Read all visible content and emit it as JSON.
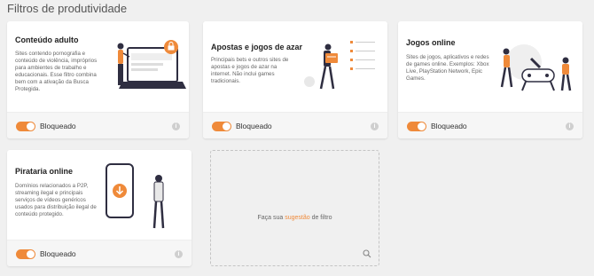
{
  "page": {
    "title": "Filtros de produtividade"
  },
  "cards": [
    {
      "title": "Conteúdo adulto",
      "description": "Sites contendo pornografia e conteúdo de violência, impróprios para ambientes de trabalho e educacionais. Esse filtro combina bem com a ativação da Busca Protegida.",
      "status": "Bloqueado",
      "enabled": true
    },
    {
      "title": "Apostas e jogos de azar",
      "description": "Principais bets e outros sites de apostas e jogos de azar na internet. Não inclui games tradicionais.",
      "status": "Bloqueado",
      "enabled": true
    },
    {
      "title": "Jogos online",
      "description": "Sites de jogos, aplicativos e redes de games online. Exemplos: Xbox Live, PlayStation Network, Epic Games.",
      "status": "Bloqueado",
      "enabled": true
    },
    {
      "title": "Pirataria online",
      "description": "Domínios relacionados a P2P, streaming ilegal e principais serviços de vídeos genéricos usados para distribuição ilegal de conteúdo protegido.",
      "status": "Bloqueado",
      "enabled": true
    }
  ],
  "suggest": {
    "prefix": "Faça sua ",
    "link": "sugestão",
    "suffix": " de filtro"
  },
  "colors": {
    "accent": "#ef8a3a",
    "toggle_knob": "#ffffff",
    "background": "#f0f0f0"
  },
  "icons": [
    "info-icon",
    "search-icon",
    "lock-icon",
    "download-icon"
  ]
}
